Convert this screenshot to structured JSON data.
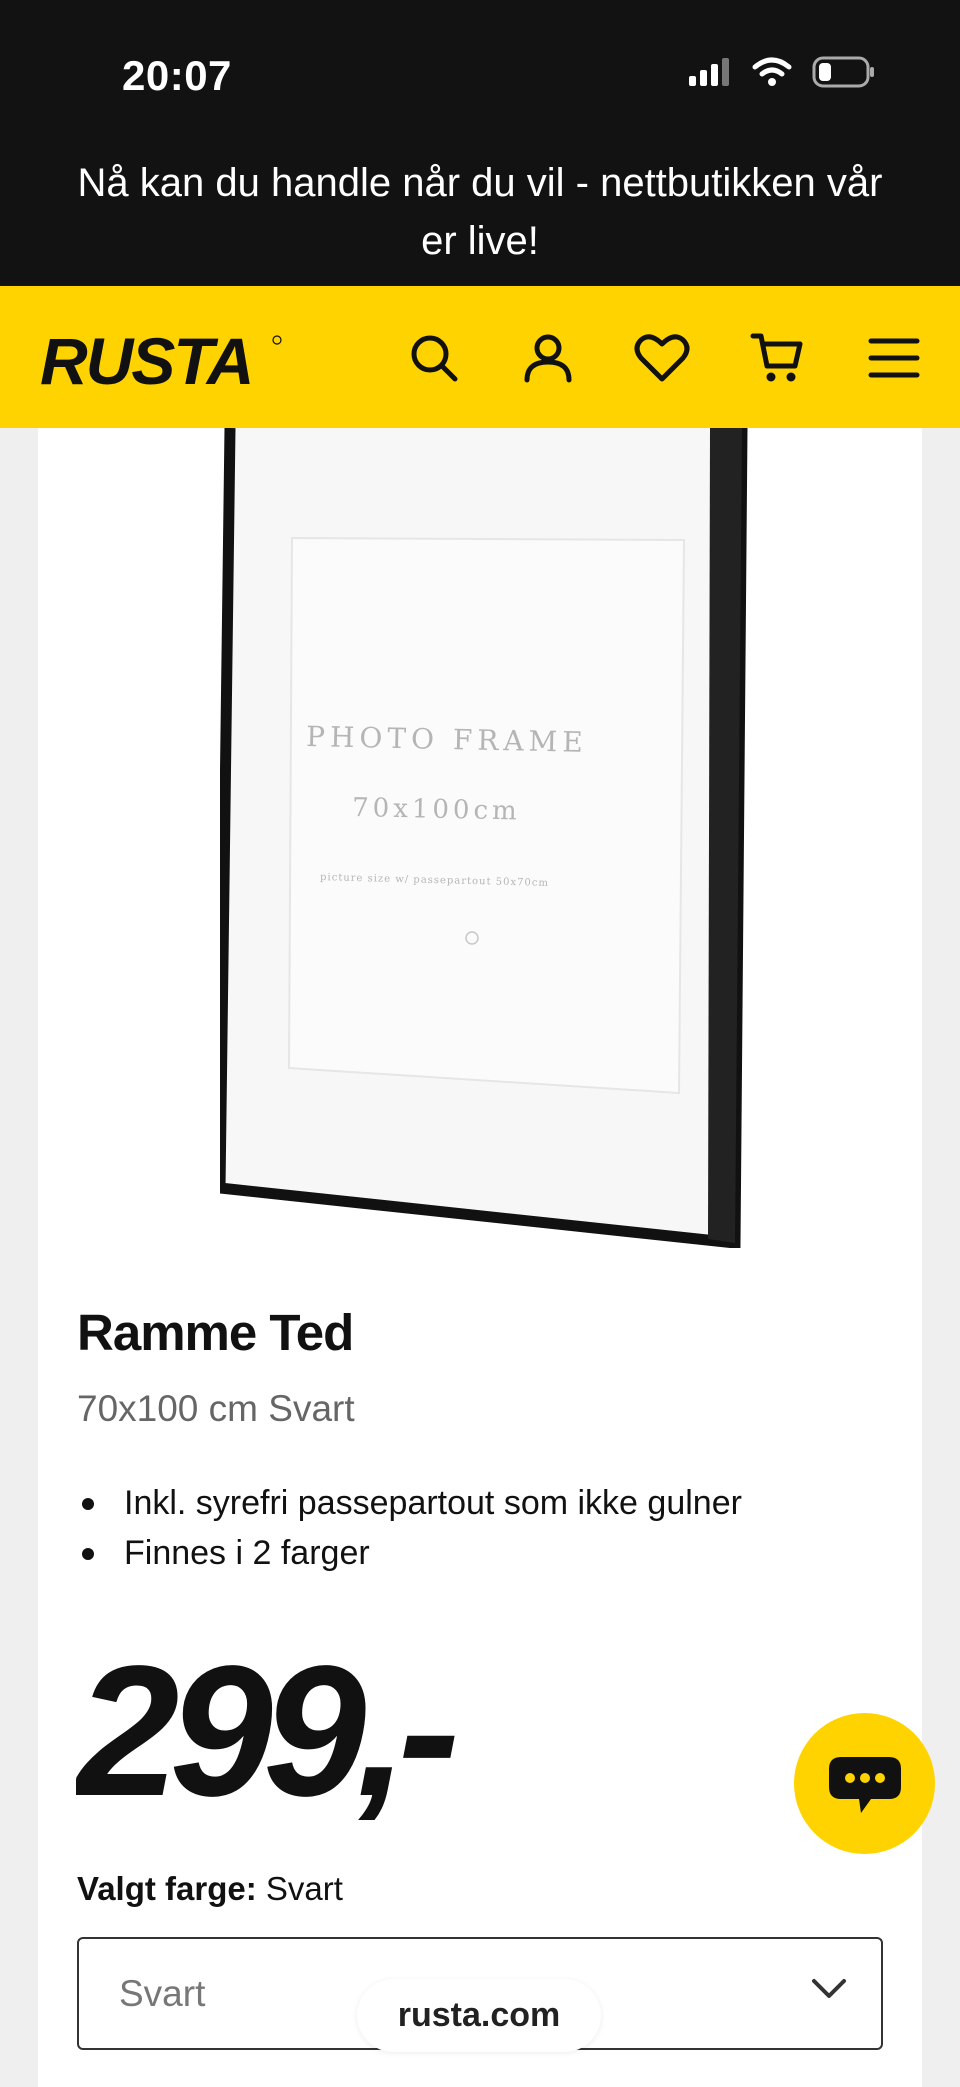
{
  "status_bar": {
    "time": "20:07",
    "icons": [
      "signal-icon",
      "wifi-icon",
      "battery-icon"
    ]
  },
  "banner": {
    "text": "Nå kan du handle når du vil - nettbutikken vår er live!"
  },
  "header": {
    "logo": "RUSTA",
    "icons": [
      "search-icon",
      "account-icon",
      "heart-icon",
      "cart-icon",
      "menu-icon"
    ],
    "background": "#ffd300"
  },
  "product": {
    "image_text": {
      "line1": "PHOTO FRAME",
      "line2": "70x100cm",
      "line3": "picture size w/ passepartout 50x70cm"
    },
    "title": "Ramme Ted",
    "subtitle": "70x100 cm Svart",
    "features": [
      "Inkl. syrefri passepartout som ikke gulner",
      "Finnes i 2 farger"
    ],
    "price": "299,-",
    "color_label": "Valgt farge:",
    "color_value": "Svart",
    "select": {
      "value": "Svart"
    }
  },
  "chat": {
    "icon": "chat-bubble-icon"
  },
  "browser": {
    "url": "rusta.com"
  }
}
